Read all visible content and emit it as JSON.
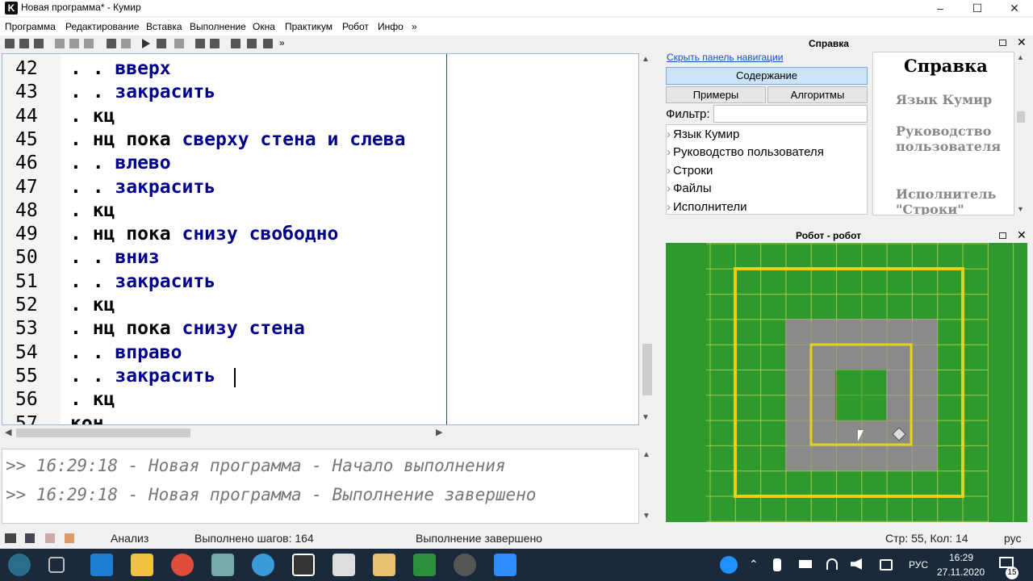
{
  "window": {
    "title": "Новая программа* - Кумир",
    "app_icon": "K"
  },
  "menu": [
    "Программа",
    "Редактирование",
    "Вставка",
    "Выполнение",
    "Окна",
    "Практикум",
    "Робот",
    "Инфо",
    "»"
  ],
  "toolbar": {
    "overflow": "»"
  },
  "editor": {
    "lines": [
      {
        "n": "42",
        "dots": ". . ",
        "kw": "",
        "cmd": "вверх"
      },
      {
        "n": "43",
        "dots": ". . ",
        "kw": "",
        "cmd": "закрасить"
      },
      {
        "n": "44",
        "dots": ". ",
        "kw": "кц",
        "cmd": ""
      },
      {
        "n": "45",
        "dots": ". ",
        "kw": "нц пока ",
        "cmd": "сверху стена и слева"
      },
      {
        "n": "46",
        "dots": ". . ",
        "kw": "",
        "cmd": "влево"
      },
      {
        "n": "47",
        "dots": ". . ",
        "kw": "",
        "cmd": "закрасить"
      },
      {
        "n": "48",
        "dots": ". ",
        "kw": "кц",
        "cmd": ""
      },
      {
        "n": "49",
        "dots": ". ",
        "kw": "нц пока ",
        "cmd": "снизу свободно"
      },
      {
        "n": "50",
        "dots": ". . ",
        "kw": "",
        "cmd": "вниз"
      },
      {
        "n": "51",
        "dots": ". . ",
        "kw": "",
        "cmd": "закрасить"
      },
      {
        "n": "52",
        "dots": ". ",
        "kw": "кц",
        "cmd": ""
      },
      {
        "n": "53",
        "dots": ". ",
        "kw": "нц пока ",
        "cmd": "снизу стена"
      },
      {
        "n": "54",
        "dots": ". . ",
        "kw": "",
        "cmd": "вправо"
      },
      {
        "n": "55",
        "dots": ". . ",
        "kw": "",
        "cmd": "закрасить"
      },
      {
        "n": "56",
        "dots": ". ",
        "kw": "кц",
        "cmd": ""
      },
      {
        "n": "57",
        "dots": "",
        "kw": "кон",
        "cmd": ""
      }
    ]
  },
  "console": {
    "lines": [
      ">> 16:29:18 - Новая программа - Начало выполнения",
      ">> 16:29:18 - Новая программа - Выполнение завершено"
    ]
  },
  "status": {
    "mode": "Анализ",
    "steps": "Выполнено шагов: 164",
    "state": "Выполнение завершено",
    "cursor": "Стр: 55, Кол: 14",
    "lang": "рус"
  },
  "help": {
    "panel_title": "Справка",
    "hide_nav": "Скрыть панель навигации",
    "contents_btn": "Содержание",
    "examples_btn": "Примеры",
    "algorithms_btn": "Алгоритмы",
    "filter_label": "Фильтр:",
    "filter_value": "",
    "tree": [
      "Язык Кумир",
      "Руководство пользователя",
      "Строки",
      "Файлы",
      "Исполнители"
    ],
    "content_title": "Справка",
    "content_links": [
      "Язык Кумир",
      "Руководство пользователя",
      "Исполнитель \"Строки\""
    ]
  },
  "robot": {
    "panel_title": "Робот - робот",
    "field_color": "#2e9a2e",
    "painted_color": "#8a8a8a",
    "wall_color": "#e6d21a"
  },
  "taskbar": {
    "time": "16:29",
    "date": "27.11.2020",
    "lang": "РУС",
    "notifications": "15"
  }
}
